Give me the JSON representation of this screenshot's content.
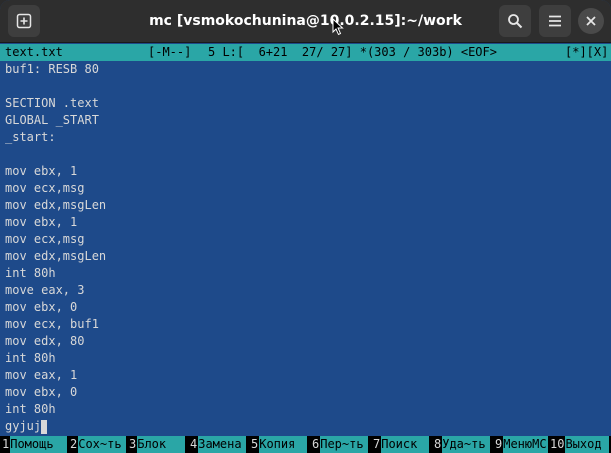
{
  "titlebar": {
    "title": "mc [vsmokochunina@10.0.2.15]:~/work",
    "new_tab_icon": "new-tab-icon",
    "search_icon": "search-icon",
    "menu_icon": "hamburger-menu-icon",
    "close_icon": "close-icon"
  },
  "status": {
    "filename": "text.txt",
    "mode": "[-M--]",
    "cursor_pos": "5 L:[  6+21  27/ 27] *(303 / 303b) <EOF>",
    "flags": "[*][X]"
  },
  "editor": {
    "lines": [
      "buf1: RESB 80",
      "",
      "SECTION .text",
      "GLOBAL _START",
      "_start:",
      "",
      "mov ebx, 1",
      "mov ecx,msg",
      "mov edx,msgLen",
      "mov ebx, 1",
      "mov ecx,msg",
      "mov edx,msgLen",
      "int 80h",
      "move eax, 3",
      "mov ebx, 0",
      "mov ecx, buf1",
      "mov edx, 80",
      "int 80h",
      "mov eax, 1",
      "mov ebx, 0",
      "int 80h",
      "gyjuj"
    ]
  },
  "fkeys": [
    {
      "num": "1",
      "label": "Помощь"
    },
    {
      "num": "2",
      "label": "Сох~ть"
    },
    {
      "num": "3",
      "label": "Блок"
    },
    {
      "num": "4",
      "label": "Замена"
    },
    {
      "num": "5",
      "label": "Копия"
    },
    {
      "num": "6",
      "label": "Пер~ть"
    },
    {
      "num": "7",
      "label": "Поиск"
    },
    {
      "num": "8",
      "label": "Уда~ть"
    },
    {
      "num": "9",
      "label": "МенюMC"
    },
    {
      "num": "10",
      "label": "Выход"
    }
  ],
  "colors": {
    "editor_bg": "#1e4a8a",
    "status_bg": "#2aa6a6",
    "text": "#d8d8d8"
  }
}
